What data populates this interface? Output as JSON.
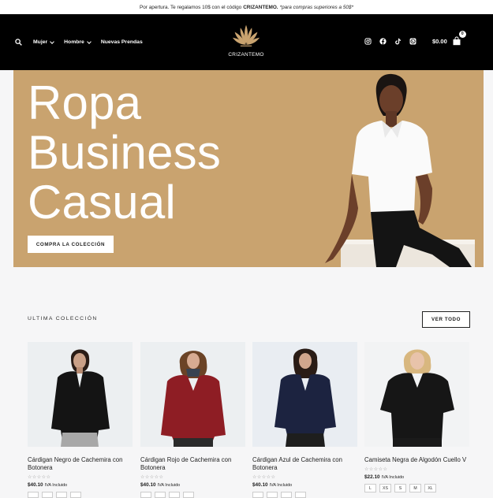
{
  "promo": {
    "text_before": "Por apertura. Te regalamos 10$ con el código",
    "code": "CRIZANTEMO.",
    "note": "*para compras superiores a 50$*"
  },
  "nav": {
    "items": [
      {
        "label": "Mujer",
        "has_dropdown": true
      },
      {
        "label": "Hombre",
        "has_dropdown": true
      },
      {
        "label": "Nuevas Prendas",
        "has_dropdown": false
      }
    ]
  },
  "brand": {
    "name": "CRIZANTEMO",
    "logo_color": "#c9a36f"
  },
  "socials": [
    "instagram-icon",
    "facebook-icon",
    "tiktok-icon",
    "whatsapp-icon"
  ],
  "cart": {
    "total": "$0.00",
    "count": "0"
  },
  "hero": {
    "title_lines": [
      "Ropa",
      "Business",
      "Casual"
    ],
    "button": "COMPRA LA COLECCIÓN",
    "bg_color": "#c9a36f"
  },
  "collection": {
    "title": "ULTIMA COLECCIÓN",
    "see_all": "VER TODO",
    "products": [
      {
        "name_line1": "Cárdigan Negro de Cachemira con",
        "name_line2": "Botonera",
        "price": "$40.10",
        "tax": "IVA Incluido",
        "stars": "☆☆☆☆☆",
        "color": "#1b1b1b"
      },
      {
        "name_line1": "Cárdigan Rojo de Cachemira con",
        "name_line2": "Botonera",
        "price": "$40.10",
        "tax": "IVA Incluido",
        "stars": "☆☆☆☆☆",
        "color": "#8e1d24"
      },
      {
        "name_line1": "Cárdigan Azul de Cachemira con",
        "name_line2": "Botonera",
        "price": "$40.10",
        "tax": "IVA Incluido",
        "stars": "☆☆☆☆☆",
        "color": "#1c2340"
      },
      {
        "name_line1": "Camiseta Negra de Algodón Cuello V",
        "name_line2": "",
        "price": "$22.10",
        "tax": "IVA Incluido",
        "stars": "☆☆☆☆☆",
        "color": "#161616",
        "sizes": [
          "L",
          "XS",
          "S",
          "M",
          "XL"
        ]
      }
    ]
  }
}
